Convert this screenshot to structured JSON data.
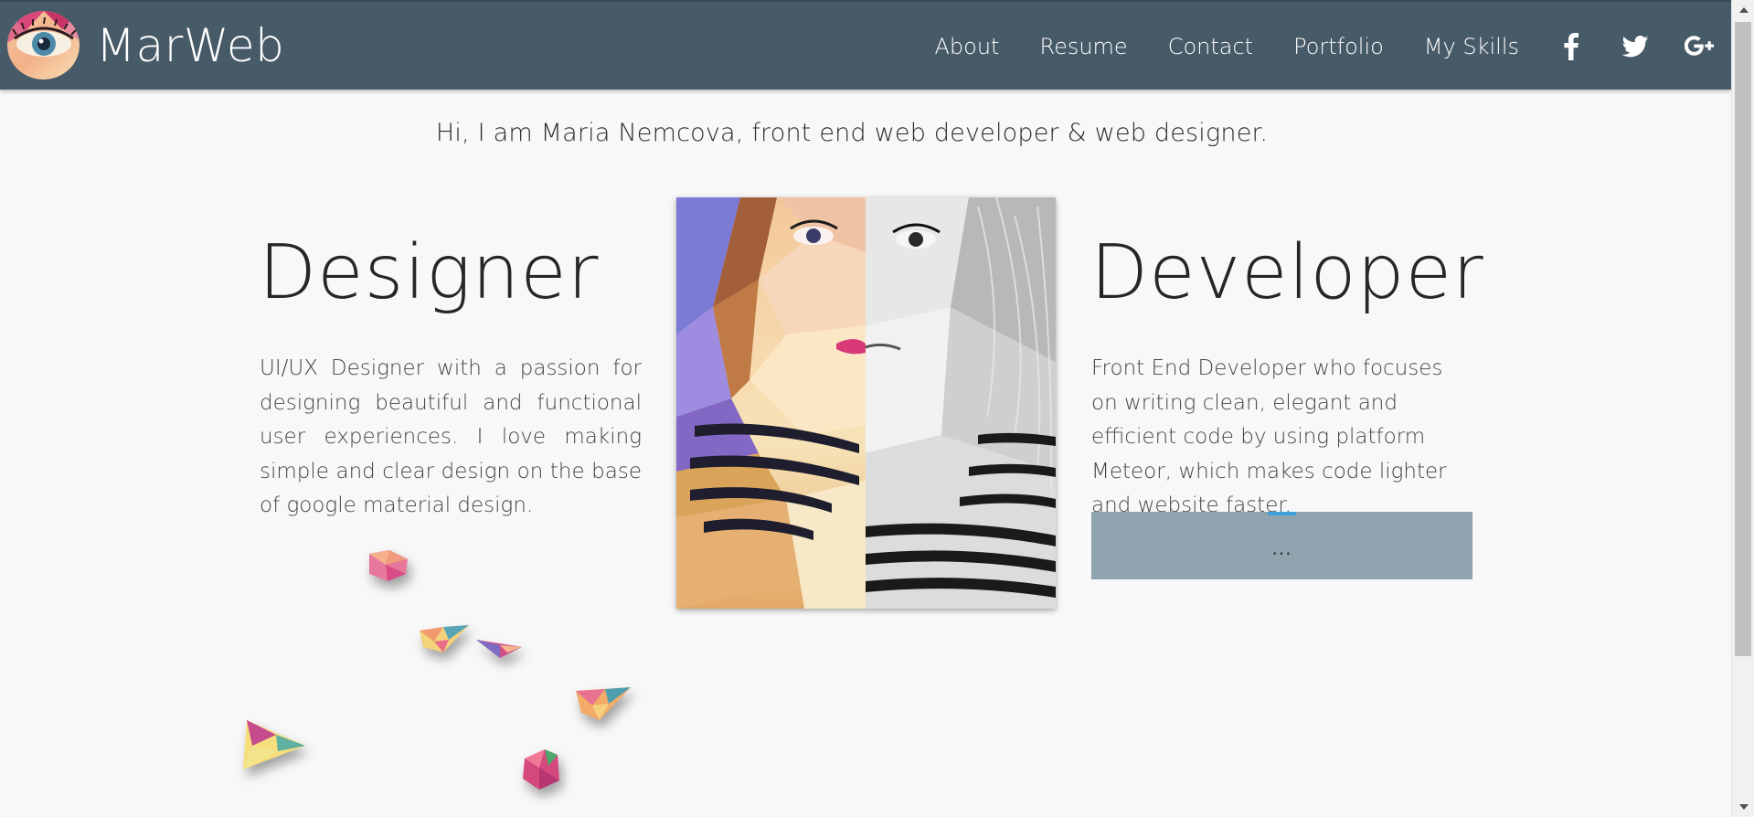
{
  "header": {
    "brand": "MarWeb",
    "nav": [
      {
        "label": "About"
      },
      {
        "label": "Resume"
      },
      {
        "label": "Contact"
      },
      {
        "label": "Portfolio"
      },
      {
        "label": "My Skills"
      }
    ],
    "social": [
      {
        "icon": "facebook-icon"
      },
      {
        "icon": "twitter-icon"
      },
      {
        "icon": "google-plus-icon"
      }
    ]
  },
  "main": {
    "intro": "Hi, I am Maria Nemcova, front end web developer & web designer.",
    "designer": {
      "heading": "Designer",
      "text": "UI/UX Designer with a passion for designing beautiful and functional user experiences. I love making simple and clear design on the base of google material design."
    },
    "developer": {
      "heading": "Developer",
      "text": "Front End Developer who focuses on writing clean, elegant and efficient code by using platform Meteor, which makes code lighter and website faster.",
      "loading_text": "..."
    }
  },
  "colors": {
    "navbar": "#475a68",
    "loading_box": "#8fa4ae",
    "accent": "#3fa0e0"
  }
}
